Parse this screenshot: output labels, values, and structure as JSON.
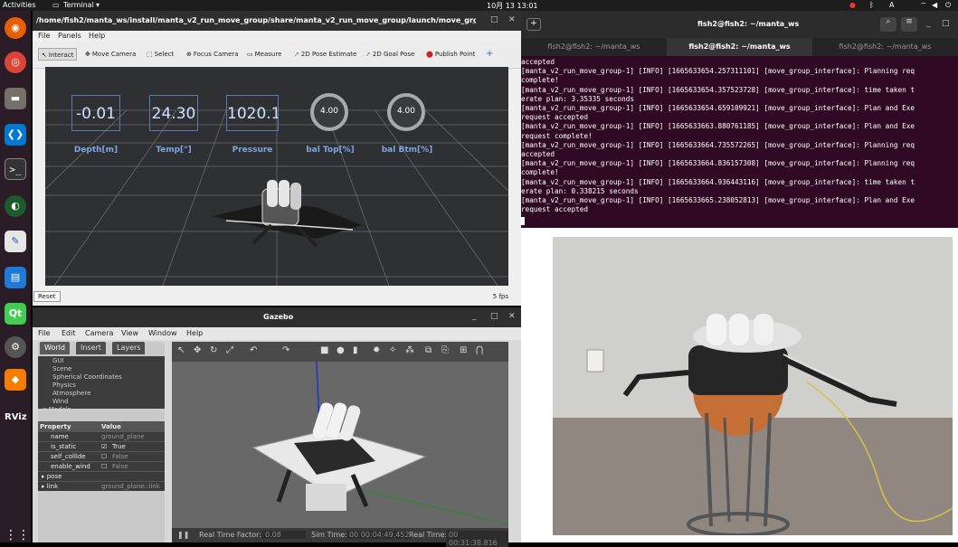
{
  "topbar": {
    "activities": "Activities",
    "app": "Terminal",
    "clock": "10月 13 13:01",
    "lang": "A"
  },
  "dock": {
    "items": [
      "firefox-icon",
      "chrome-icon",
      "files-icon",
      "vscode-icon",
      "terminal-icon",
      "globe-icon",
      "editor-icon",
      "writer-icon",
      "qt-icon",
      "settings-icon",
      "layers-icon",
      "rviz-icon",
      "apps-grid-icon"
    ],
    "rviz_label": "RViz",
    "qt_label": "Qt"
  },
  "rviz": {
    "title": "/home/fish2/manta_ws/install/manta_v2_run_move_group/share/manta_v2_run_move_group/launch/move_group.rv...",
    "menu": [
      "File",
      "Panels",
      "Help"
    ],
    "tools": [
      {
        "icon": "cursor-icon",
        "label": "Interact"
      },
      {
        "icon": "move-icon",
        "label": "Move Camera"
      },
      {
        "icon": "select-icon",
        "label": "Select"
      },
      {
        "icon": "focus-icon",
        "label": "Focus Camera"
      },
      {
        "icon": "measure-icon",
        "label": "Measure"
      },
      {
        "icon": "pose-icon",
        "label": "2D Pose Estimate"
      },
      {
        "icon": "goal-icon",
        "label": "2D Goal Pose"
      },
      {
        "icon": "pin-icon",
        "label": "Publish Point"
      }
    ],
    "plus": "+",
    "gauges": [
      {
        "value": "-0.01",
        "label": "Depth[m]"
      },
      {
        "value": "24.30",
        "label": "Temp[°]"
      },
      {
        "value": "1020.1(",
        "label": "Pressure"
      }
    ],
    "dials": [
      {
        "value": "4.00",
        "label": "bal Top[%]"
      },
      {
        "value": "4.00",
        "label": "bal Btm[%]"
      }
    ],
    "reset": "Reset",
    "fps": "5 fps"
  },
  "gazebo": {
    "title": "Gazebo",
    "menu": [
      "File",
      "Edit",
      "Camera",
      "View",
      "Window",
      "Help"
    ],
    "tabs": [
      "World",
      "Insert",
      "Layers"
    ],
    "tree": [
      "GUI",
      "Scene",
      "Spherical Coordinates",
      "Physics",
      "Atmosphere",
      "Wind",
      "▾ Models"
    ],
    "prop_head": [
      "Property",
      "Value"
    ],
    "props": [
      {
        "k": "name",
        "v": "ground_plane"
      },
      {
        "k": "is_static",
        "v": "True",
        "check": true
      },
      {
        "k": "self_collide",
        "v": "False",
        "check": false
      },
      {
        "k": "enable_wind",
        "v": "False",
        "check": false
      },
      {
        "k": "▸ pose",
        "v": ""
      },
      {
        "k": "▸ link",
        "v": "ground_plane::link"
      }
    ],
    "status": {
      "rtf_label": "Real Time Factor:",
      "rtf": "0.08",
      "sim_label": "Sim Time:",
      "sim": "00 00:04:49.452",
      "real_label": "Real Time:",
      "real": "00 00:31:38.816"
    }
  },
  "terminal": {
    "title": "fish2@fish2: ~/manta_ws",
    "tabs": [
      "fish2@fish2: ~/manta_ws",
      "fish2@fish2: ~/manta_ws",
      "fish2@fish2: ~/manta_ws"
    ],
    "lines": [
      "accepted",
      "[manta_v2_run_move_group-1] [INFO] [1665633654.257311101] [move_group_interface]: Planning req",
      "complete!",
      "[manta_v2_run_move_group-1] [INFO] [1665633654.357523728] [move_group_interface]: time taken t",
      "erate plan: 3.35335 seconds",
      "[manta_v2_run_move_group-1] [INFO] [1665633654.659109921] [move_group_interface]: Plan and Exe",
      "request accepted",
      "[manta_v2_run_move_group-1] [INFO] [1665633663.880761185] [move_group_interface]: Plan and Exe",
      "request complete!",
      "[manta_v2_run_move_group-1] [INFO] [1665633664.735572265] [move_group_interface]: Planning req",
      "accepted",
      "[manta_v2_run_move_group-1] [INFO] [1665633664.836157308] [move_group_interface]: Planning req",
      "complete!",
      "[manta_v2_run_move_group-1] [INFO] [1665633664.936443116] [move_group_interface]: time taken t",
      "erate plan: 0.338215 seconds",
      "[manta_v2_run_move_group-1] [INFO] [1665633665.238052813] [move_group_interface]: Plan and Exe",
      "request accepted"
    ]
  }
}
